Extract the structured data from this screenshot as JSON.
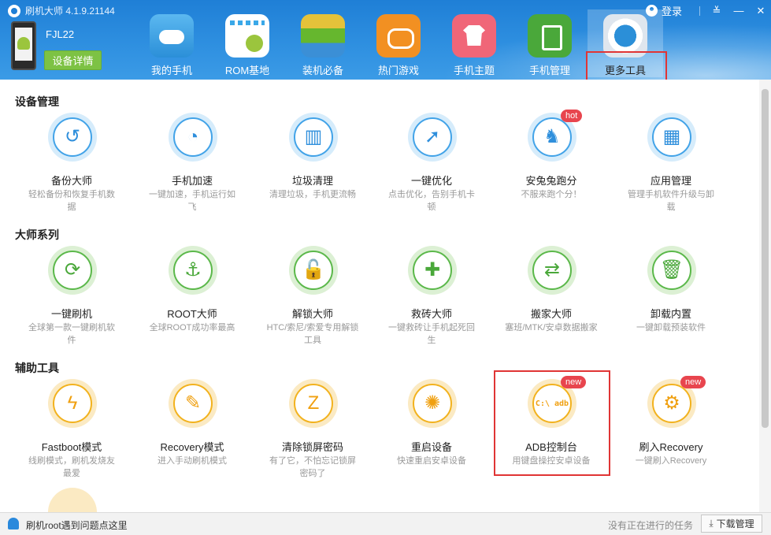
{
  "app": {
    "title": "刷机大师 4.1.9.21144"
  },
  "window": {
    "login_label": "登录",
    "menu_icon": "≚",
    "minimize_icon": "—",
    "close_icon": "✕"
  },
  "device": {
    "name": "FJL22",
    "detail_button": "设备详情"
  },
  "nav": [
    {
      "label": "我的手机",
      "icon": "cloud-icon"
    },
    {
      "label": "ROM基地",
      "icon": "rom-bag-icon"
    },
    {
      "label": "装机必备",
      "icon": "app-stack-icon"
    },
    {
      "label": "热门游戏",
      "icon": "gamepad-icon"
    },
    {
      "label": "手机主题",
      "icon": "tshirt-icon"
    },
    {
      "label": "手机管理",
      "icon": "shield-phone-icon"
    },
    {
      "label": "更多工具",
      "icon": "gear-wrench-icon",
      "active": true
    }
  ],
  "sections": [
    {
      "title": "设备管理",
      "tools": [
        {
          "name": "备份大师",
          "desc": "轻松备份和恢复手机数据",
          "glyph": "↺",
          "icon": "backup-icon"
        },
        {
          "name": "手机加速",
          "desc": "一键加速，手机运行如飞",
          "glyph": "◔",
          "icon": "speedometer-icon"
        },
        {
          "name": "垃圾清理",
          "desc": "清理垃圾，手机更流畅",
          "glyph": "▥",
          "icon": "broom-icon"
        },
        {
          "name": "一键优化",
          "desc": "点击优化，告别手机卡顿",
          "glyph": "➚",
          "icon": "rocket-icon"
        },
        {
          "name": "安兔兔跑分",
          "desc": "不服来跑个分！",
          "glyph": "♞",
          "icon": "antutu-icon",
          "badge": "hot"
        },
        {
          "name": "应用管理",
          "desc": "管理手机软件升级与卸载",
          "glyph": "▦",
          "icon": "app-grid-icon"
        }
      ]
    },
    {
      "title": "大师系列",
      "tools": [
        {
          "name": "一键刷机",
          "desc": "全球第一款一键刷机软件",
          "glyph": "⟳",
          "icon": "refresh-icon"
        },
        {
          "name": "ROOT大师",
          "desc": "全球ROOT成功率最高",
          "glyph": "⚓",
          "icon": "anchor-icon"
        },
        {
          "name": "解锁大师",
          "desc": "HTC/索尼/索爱专用解锁工具",
          "glyph": "🔓",
          "icon": "unlock-icon"
        },
        {
          "name": "救砖大师",
          "desc": "一键救砖让手机起死回生",
          "glyph": "✚",
          "icon": "phone-plus-icon"
        },
        {
          "name": "搬家大师",
          "desc": "塞班/MTK/安卓数据搬家",
          "glyph": "⇄",
          "icon": "transfer-icon"
        },
        {
          "name": "卸载内置",
          "desc": "一键卸载预装软件",
          "glyph": "🗑",
          "icon": "trash-icon"
        }
      ]
    },
    {
      "title": "辅助工具",
      "tools": [
        {
          "name": "Fastboot模式",
          "desc": "线刷模式，刷机发烧友最爱",
          "glyph": "ϟ",
          "icon": "lightning-icon"
        },
        {
          "name": "Recovery模式",
          "desc": "进入手动刷机模式",
          "glyph": "✎",
          "icon": "recovery-icon"
        },
        {
          "name": "清除锁屏密码",
          "desc": "有了它，不怕忘记锁屏密码了",
          "glyph": "Z",
          "icon": "pattern-lock-icon"
        },
        {
          "name": "重启设备",
          "desc": "快速重启安卓设备",
          "glyph": "✺",
          "icon": "restart-icon"
        },
        {
          "name": "ADB控制台",
          "desc": "用键盘操控安卓设备",
          "glyph": "C:\\ adb",
          "icon": "adb-console-icon",
          "badge": "new"
        },
        {
          "name": "刷入Recovery",
          "desc": "一键刷入Recovery",
          "glyph": "⚙",
          "icon": "flash-recovery-icon",
          "badge": "new"
        }
      ]
    }
  ],
  "footer": {
    "help_text": "刷机root遇到问题点这里",
    "status_text": "没有正在进行的任务",
    "download_button": "下载管理"
  },
  "colors": {
    "header_blue": "#2a89dc",
    "accent_green": "#7dc244",
    "highlight_red": "#e03535",
    "blue_tool": "#42a3e8",
    "green_tool": "#5bb84a",
    "orange_tool": "#f2b21e"
  }
}
